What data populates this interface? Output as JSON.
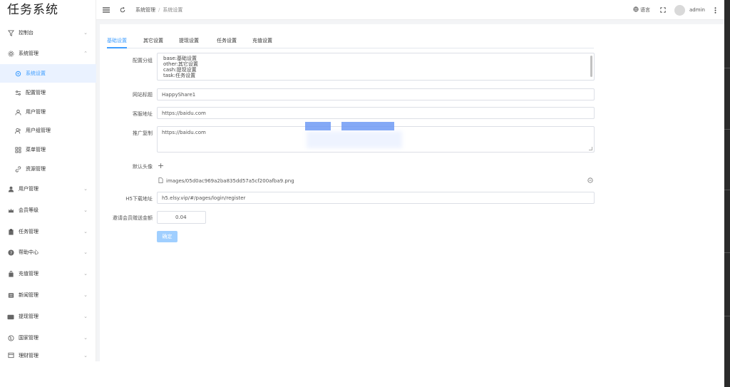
{
  "app": {
    "title": "任务系统"
  },
  "header": {
    "breadcrumb": [
      "系统管理",
      "系统设置"
    ],
    "language_label": "语言",
    "username": "admin"
  },
  "sidebar": {
    "items": [
      {
        "label": "控制台",
        "icon": "filter-icon"
      },
      {
        "label": "系统管理",
        "icon": "gear-icon",
        "expanded": true
      },
      {
        "label": "系统设置",
        "icon": "settings-icon",
        "active": true
      },
      {
        "label": "配置管理",
        "icon": "sliders-icon"
      },
      {
        "label": "用户管理",
        "icon": "user-icon"
      },
      {
        "label": "用户组管理",
        "icon": "user-group-icon"
      },
      {
        "label": "菜单管理",
        "icon": "grid-icon"
      },
      {
        "label": "资源管理",
        "icon": "link-icon"
      },
      {
        "label": "用户管理",
        "icon": "person-icon"
      },
      {
        "label": "会员等级",
        "icon": "crown-icon"
      },
      {
        "label": "任务管理",
        "icon": "clipboard-icon"
      },
      {
        "label": "帮助中心",
        "icon": "help-icon"
      },
      {
        "label": "充值管理",
        "icon": "bag-icon"
      },
      {
        "label": "新闻管理",
        "icon": "news-icon"
      },
      {
        "label": "提现管理",
        "icon": "wallet-icon"
      },
      {
        "label": "国家管理",
        "icon": "globe-icon"
      },
      {
        "label": "理财管理",
        "icon": "finance-icon"
      }
    ]
  },
  "tabs": [
    "基础设置",
    "其它设置",
    "提现设置",
    "任务设置",
    "充值设置"
  ],
  "form": {
    "group_label": "配置分组",
    "group_options": [
      "base:基础设置",
      "other:其它设置",
      "cash:提现设置",
      "task:任务设置"
    ],
    "site_title_label": "网站标题",
    "site_title_value": "HappyShare1",
    "service_url_label": "客服地址",
    "service_url_value": "https://baidu.com",
    "promo_copy_label": "推广复制",
    "promo_copy_value": "https://baidu.com",
    "avatar_label": "默认头像",
    "add_symbol": "+",
    "avatar_file": "images/05d0ac969a2ba835dd57a5cf200afba9.png",
    "h5_label": "H5下载地址",
    "h5_value": "h5.elsy.vip/#/pages/login/register",
    "reward_label": "邀请会员赠送金额",
    "reward_value": "0.04",
    "submit_label": "确定"
  }
}
